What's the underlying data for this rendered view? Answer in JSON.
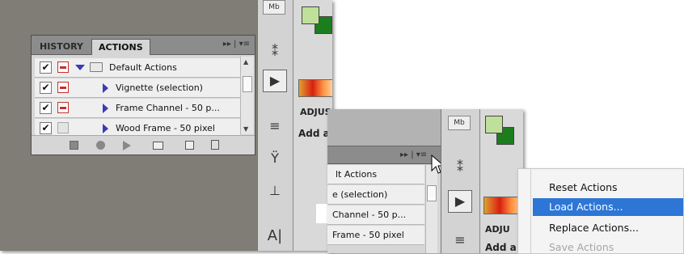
{
  "panel": {
    "tabs": [
      {
        "label": "HISTORY"
      },
      {
        "label": "ACTIONS"
      }
    ],
    "menu_glyph": "▸▸ | ▾≡",
    "rows": [
      {
        "label": "Default Actions",
        "checked": true,
        "dialog": "red",
        "expanded": true,
        "is_set": true
      },
      {
        "label": "Vignette (selection)",
        "checked": true,
        "dialog": "red"
      },
      {
        "label": "Frame Channel - 50 p...",
        "checked": true,
        "dialog": "red"
      },
      {
        "label": "Wood Frame - 50 pixel",
        "checked": true,
        "dialog": "none"
      }
    ],
    "footer_icons": [
      "stop-icon",
      "record-icon",
      "play-icon",
      "new-set-icon",
      "new-action-icon",
      "trash-icon"
    ]
  },
  "dock": {
    "mb_label": "Mb",
    "adjust_label": "ADJUS",
    "add_label": "Add a",
    "a_label": "A|"
  },
  "crop2": {
    "menu_glyph": "▸▸ | ▾≡",
    "rows": [
      "lt Actions",
      "e (selection)",
      "Channel - 50 p...",
      "Frame - 50 pixel"
    ],
    "mb_label": "Mb",
    "adju_label": "ADJU",
    "add_label": "Add a"
  },
  "menu": {
    "items": [
      {
        "label": "Reset Actions",
        "state": "normal"
      },
      {
        "label": "Load Actions...",
        "state": "highlighted"
      },
      {
        "label": "Replace Actions...",
        "state": "normal"
      },
      {
        "label": "Save Actions",
        "state": "disabled"
      }
    ]
  },
  "colors": {
    "accent_highlight": "#2d76d6",
    "foreground_swatch": "#bfe09a",
    "background_swatch": "#1c7d1c",
    "action_triangle": "#3c3ab8"
  }
}
